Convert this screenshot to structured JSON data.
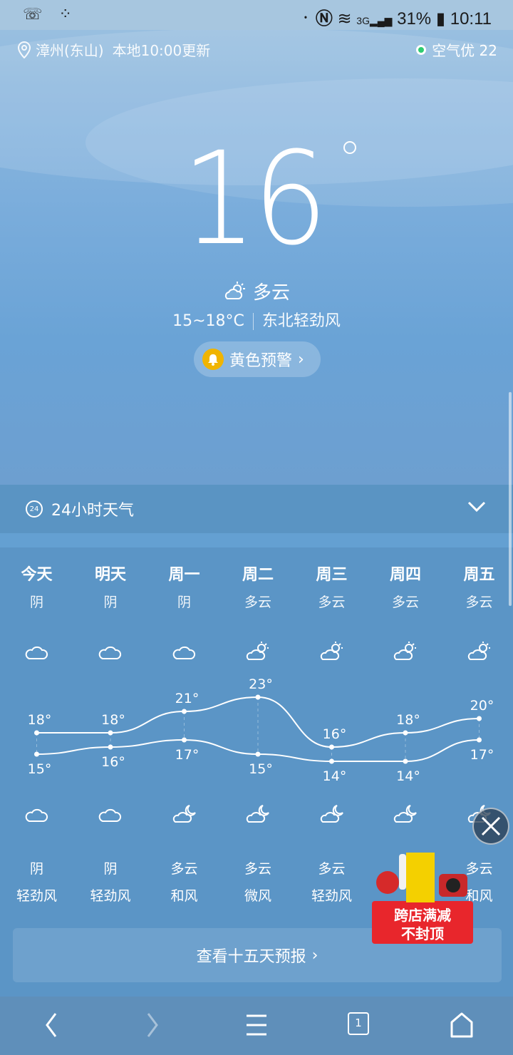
{
  "status": {
    "battery": "31%",
    "time": "10:11"
  },
  "header": {
    "location": "漳州(东山)",
    "update": "本地10:00更新",
    "air_quality": "空气优 22"
  },
  "current": {
    "temp": "16",
    "condition": "多云",
    "range": "15~18°C",
    "wind": "东北轻劲风",
    "warning": "黄色预警"
  },
  "hourly": {
    "title": "24小时天气",
    "icon_text": "24"
  },
  "forecast": {
    "days": [
      {
        "day": "今天",
        "day_cond": "阴",
        "day_icon": "cloud-icon",
        "high": "18°",
        "low": "15°",
        "night_icon": "cloud-icon",
        "night_cond": "阴",
        "wind": "轻劲风"
      },
      {
        "day": "明天",
        "day_cond": "阴",
        "day_icon": "cloud-icon",
        "high": "18°",
        "low": "16°",
        "night_icon": "cloud-icon",
        "night_cond": "阴",
        "wind": "轻劲风"
      },
      {
        "day": "周一",
        "day_cond": "阴",
        "day_icon": "cloud-icon",
        "high": "21°",
        "low": "17°",
        "night_icon": "moon-cloud-icon",
        "night_cond": "多云",
        "wind": "和风"
      },
      {
        "day": "周二",
        "day_cond": "多云",
        "day_icon": "sun-cloud-icon",
        "high": "23°",
        "low": "15°",
        "night_icon": "moon-cloud-icon",
        "night_cond": "多云",
        "wind": "微风"
      },
      {
        "day": "周三",
        "day_cond": "多云",
        "day_icon": "sun-cloud-icon",
        "high": "16°",
        "low": "14°",
        "night_icon": "moon-cloud-icon",
        "night_cond": "多云",
        "wind": "轻劲风"
      },
      {
        "day": "周四",
        "day_cond": "多云",
        "day_icon": "sun-cloud-icon",
        "high": "18°",
        "low": "14°",
        "night_icon": "moon-cloud-icon",
        "night_cond": "",
        "wind": ""
      },
      {
        "day": "周五",
        "day_cond": "多云",
        "day_icon": "sun-cloud-icon",
        "high": "20°",
        "low": "17°",
        "night_icon": "moon-cloud-icon",
        "night_cond": "多云",
        "wind": "和风"
      }
    ],
    "highs": [
      18,
      18,
      21,
      23,
      16,
      18,
      20
    ],
    "lows": [
      15,
      16,
      17,
      15,
      14,
      14,
      17
    ],
    "fifteen_day_label": "查看十五天预报"
  },
  "ad": {
    "line1": "跨店满减",
    "line2": "不封顶"
  },
  "nav": {
    "tab_count": "1"
  }
}
